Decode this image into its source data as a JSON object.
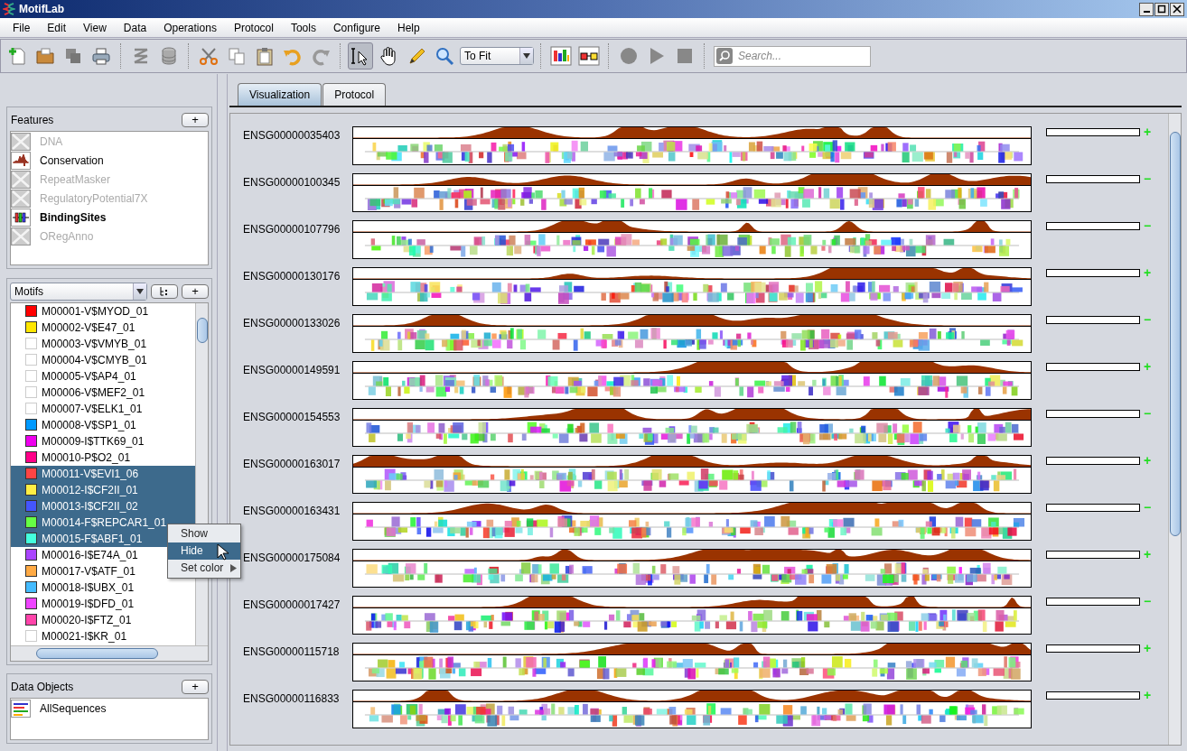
{
  "window": {
    "title": "MotifLab"
  },
  "menu": [
    "File",
    "Edit",
    "View",
    "Data",
    "Operations",
    "Protocol",
    "Tools",
    "Configure",
    "Help"
  ],
  "toolbar": {
    "zoom_select": "To Fit",
    "search": {
      "placeholder": "Search..."
    }
  },
  "features": {
    "title": "Features",
    "add_button": "+",
    "items": [
      {
        "name": "DNA",
        "kind": "dna",
        "visible": false,
        "selected": false
      },
      {
        "name": "Conservation",
        "kind": "numeric",
        "visible": true,
        "selected": false
      },
      {
        "name": "RepeatMasker",
        "kind": "region",
        "visible": false,
        "selected": false
      },
      {
        "name": "RegulatoryPotential7X",
        "kind": "numeric",
        "visible": false,
        "selected": false
      },
      {
        "name": "BindingSites",
        "kind": "sites",
        "visible": true,
        "selected": true
      },
      {
        "name": "ORegAnno",
        "kind": "region",
        "visible": false,
        "selected": false
      }
    ]
  },
  "motifs_panel": {
    "type_select": "Motifs",
    "add_button": "+",
    "items": [
      {
        "name": "M00001-V$MYOD_01",
        "color": "#ff0000",
        "selected": false
      },
      {
        "name": "M00002-V$E47_01",
        "color": "#ffe600",
        "selected": false
      },
      {
        "name": "M00003-V$VMYB_01",
        "selected": false
      },
      {
        "name": "M00004-V$CMYB_01",
        "selected": false
      },
      {
        "name": "M00005-V$AP4_01",
        "selected": false
      },
      {
        "name": "M00006-V$MEF2_01",
        "selected": false
      },
      {
        "name": "M00007-V$ELK1_01",
        "selected": false
      },
      {
        "name": "M00008-V$SP1_01",
        "color": "#0099ff",
        "selected": false
      },
      {
        "name": "M00009-I$TTK69_01",
        "color": "#ee00ee",
        "selected": false
      },
      {
        "name": "M00010-P$O2_01",
        "color": "#ff0088",
        "selected": false
      },
      {
        "name": "M00011-V$EVI1_06",
        "color": "#ff4444",
        "selected": true
      },
      {
        "name": "M00012-I$CF2II_01",
        "color": "#ffee44",
        "selected": true
      },
      {
        "name": "M00013-I$CF2II_02",
        "color": "#4455ff",
        "selected": true
      },
      {
        "name": "M00014-F$REPCAR1_01",
        "color": "#66ff44",
        "selected": true
      },
      {
        "name": "M00015-F$ABF1_01",
        "color": "#44ffdd",
        "selected": true
      },
      {
        "name": "M00016-I$E74A_01",
        "color": "#aa44ff",
        "selected": false
      },
      {
        "name": "M00017-V$ATF_01",
        "color": "#ffaa44",
        "selected": false
      },
      {
        "name": "M00018-I$UBX_01",
        "color": "#44bbff",
        "selected": false
      },
      {
        "name": "M00019-I$DFD_01",
        "color": "#ee44ff",
        "selected": false
      },
      {
        "name": "M00020-I$FTZ_01",
        "color": "#ff44aa",
        "selected": false
      },
      {
        "name": "M00021-I$KR_01",
        "selected": false
      }
    ]
  },
  "context_menu": [
    {
      "label": "Show",
      "selected": false
    },
    {
      "label": "Hide",
      "selected": true
    },
    {
      "label": "Set color",
      "selected": false,
      "submenu": true
    }
  ],
  "data_objects": {
    "title": "Data Objects",
    "add_button": "+",
    "items": [
      {
        "name": "AllSequences"
      }
    ]
  },
  "tabs": [
    {
      "label": "Visualization",
      "selected": true
    },
    {
      "label": "Protocol",
      "selected": false
    }
  ],
  "sequences": [
    {
      "name": "ENSG00000035403",
      "strand": "+"
    },
    {
      "name": "ENSG00000100345",
      "strand": "−"
    },
    {
      "name": "ENSG00000107796",
      "strand": "−"
    },
    {
      "name": "ENSG00000130176",
      "strand": "+"
    },
    {
      "name": "ENSG00000133026",
      "strand": "−"
    },
    {
      "name": "ENSG00000149591",
      "strand": "+"
    },
    {
      "name": "ENSG00000154553",
      "strand": "−"
    },
    {
      "name": "ENSG00000163017",
      "strand": "+"
    },
    {
      "name": "ENSG00000163431",
      "strand": "−"
    },
    {
      "name": "ENSG00000175084",
      "strand": "+"
    },
    {
      "name": "ENSG00000017427",
      "strand": "−"
    },
    {
      "name": "ENSG00000115718",
      "strand": "+"
    },
    {
      "name": "ENSG00000116833",
      "strand": "+"
    }
  ]
}
